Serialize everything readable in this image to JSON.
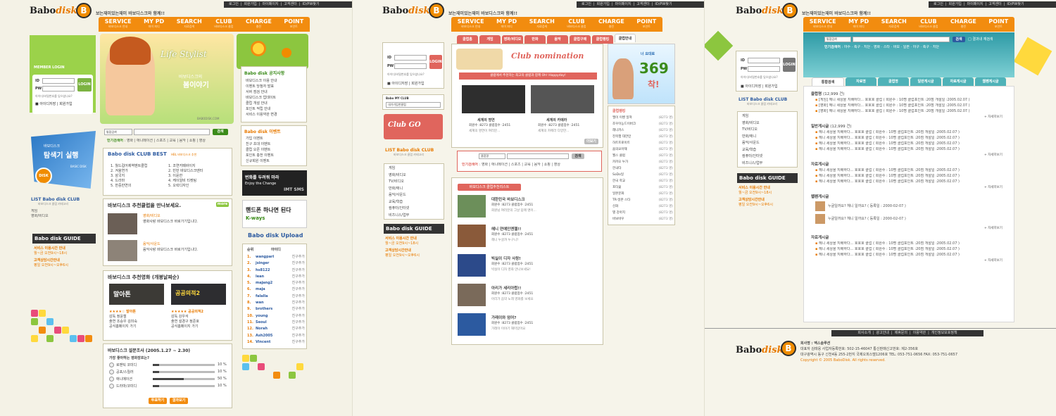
{
  "brand": {
    "logo_main": "Babo",
    "logo_accent": "disk",
    "mascot_letter": "B",
    "slogan": "보는재미있는재미 바보디스크와 함께!!"
  },
  "toplinks": [
    "로그인",
    "회원가입",
    "마이페이지",
    "고객센터",
    "ID/PW찾기"
  ],
  "nav": [
    {
      "label": "SERVICE",
      "sub": "바보디스크 안내"
    },
    {
      "label": "MY PD",
      "sub": "마이 피디"
    },
    {
      "label": "SEARCH",
      "sub": "자료검색"
    },
    {
      "label": "CLUB",
      "sub": "바보디스크 클럽"
    },
    {
      "label": "CHARGE",
      "sub": "충전"
    },
    {
      "label": "POINT",
      "sub": "포인트"
    }
  ],
  "login": {
    "title": "MEMBER LOGIN",
    "id_label": "ID",
    "pw_label": "PW",
    "button": "LOGIN",
    "hint": "아이디/비밀번호를 잊으셨나요?",
    "save": "아이디저장",
    "join": "회원가입"
  },
  "explorer": {
    "small": "바보디스크",
    "title": "탐색기 실행",
    "tag": "BASIC DISK",
    "mark": "DISK"
  },
  "list_menu": {
    "title": "LIST Babo disk CLUB",
    "subtitle": "바보디스크 클럽 카테고리",
    "items": [
      "게임",
      "영화/비디오",
      "TV/비디오",
      "만화/애니",
      "음악/사운드",
      "교육/학습",
      "컴퓨터/인터넷",
      "비즈니스/업무"
    ]
  },
  "guide": {
    "title": "Babo disk GUIDE",
    "items": [
      "서비스 이용시간 안내",
      "고객상담시간안내"
    ],
    "hours": [
      "월~금 오전9시~18시",
      "평일 오전9시~오후6시"
    ]
  },
  "hero": {
    "title": "Life Stylist",
    "small": "바보디스크의",
    "big": "봄이야기",
    "url": "BABODISK.COM"
  },
  "search": {
    "select": "통합검색",
    "button": "검색"
  },
  "keywords": {
    "label": "인기검색어",
    "items": [
      "영화",
      "애니메이션",
      "스포츠",
      "교육",
      "음악",
      "쇼핑",
      "영상"
    ]
  },
  "club_best": {
    "title": "Babo disk CLUB BEST",
    "tag": "HBL 바보디스크 추천",
    "left": [
      "월드컵어제역벤트클럽",
      "겨울연가",
      "삼국지",
      "드라마",
      "한중만연의"
    ],
    "right": [
      "조연카페바이지",
      "빈빈 바보디스크엔터",
      "이윤한",
      "케이알비 티켓팅",
      "오락디자인"
    ]
  },
  "recommend": {
    "title": "바보디스크 추천클럽을 만나보세요.",
    "more": "more",
    "items": [
      {
        "cat": "영화/비디오",
        "desc": "영화사랑 바보디스크 바로가기입니다."
      },
      {
        "cat": "음악/사운드",
        "desc": "음악사랑 바보디스크 바로가기입니다."
      }
    ]
  },
  "movie": {
    "title": "바보디스크 추천영화 (개봉날짜순)",
    "items": [
      {
        "poster": "말아톤",
        "rating": "★★★★☆ 말아톤",
        "info": [
          "감독 정윤철",
          "출연 조승우 김미숙",
          "공식홈페이지 가기"
        ]
      },
      {
        "poster": "공공의적2",
        "rating": "★★★★★ 공공의적2",
        "info": [
          "감독 강우석",
          "출연 설경구 정준호",
          "공식홈페이지 가기"
        ]
      }
    ]
  },
  "poll": {
    "title": "바보디스크 설문조사 (2005.1.27 ~ 2.30)",
    "question": "가장 좋아하는 영화장르는?",
    "options": [
      {
        "label": "로맨틱 코미디",
        "pct": 10
      },
      {
        "label": "공포/스릴러",
        "pct": 10
      },
      {
        "label": "애니메이션",
        "pct": 50
      },
      {
        "label": "드라마/코미디",
        "pct": 10
      }
    ],
    "unit": "%",
    "buttons": [
      "투표하기",
      "결과보기"
    ]
  },
  "right_col": {
    "notice_title": "Babo disk 공지사항",
    "notice": [
      "바보디스크 이용 안내",
      "이벤트 당첨자 발표",
      "서버 점검 안내",
      "바보디스크 업데이트",
      "클럽 개설 안내",
      "포인트 적립 안내",
      "서비스 이용약관 변경"
    ],
    "event_title": "Babo disk 이벤트",
    "event": [
      "가입 이벤트",
      "친구 초대 이벤트",
      "클럽 오픈 이벤트",
      "포인트 충전 이벤트",
      "신규회원 이벤트"
    ],
    "banner1": [
      "번화를 두려워 마라",
      "Enjoy the Change",
      "IMT SMS"
    ],
    "banner2": [
      "핸드폰 하나면 된다",
      "K-ways"
    ],
    "upload_title": "Babo disk Upload",
    "upload_cols": [
      "순위",
      "아이디"
    ],
    "upload": [
      "wangpari",
      "jsinger",
      "hs8122",
      "lean",
      "majang2",
      "maja",
      "falalla",
      "wan",
      "brothers",
      "young",
      "Seoul",
      "Norah",
      "Ash2005",
      "Vincent"
    ],
    "upload_action": "친구추가"
  },
  "p2": {
    "tabs": [
      "클럽홈",
      "게임",
      "영화/비디오",
      "만화",
      "음악",
      "클럽구매",
      "클럽랭킹",
      "클럽안내"
    ],
    "my_club": {
      "title": "Babo MY CLUB",
      "select": "내가가입한클럽"
    },
    "banner": "Club GO",
    "nomination": {
      "title": "Club nomination",
      "sub": "클럽에서 추천하는 최고의 클럽과 함께 Oh! Happyday!"
    },
    "nom_items": [
      {
        "name": "세계의 명연",
        "info": "회원수 :8273 클럽점수 :2451",
        "desc": "세계의 명연이 여러분..."
      },
      {
        "name": "세계의 카메라",
        "info": "회원수 :8273 클럽점수 :2451",
        "desc": "세계의 카메라 다양한..."
      }
    ],
    "more": "더보기",
    "search_select": "클럽명",
    "search_button": "검색",
    "keyword_label": "인기검색어",
    "keywords": [
      "영화",
      "애니메이션",
      "스포츠",
      "교육",
      "음악",
      "쇼핑",
      "영상"
    ],
    "rec_title": "바보디스크 클럽추천리스트",
    "rec_items": [
      {
        "name": "대한민국 바보디스크",
        "info": "회원수 :8273 클럽점수 :2451",
        "desc": "회원님 여러분의 그날 답례 명이..."
      },
      {
        "name": "헤니 연예인엔젤!!",
        "info": "회원수 :8273 클럽점수 :2451",
        "desc": "헤니 누굴까 누구니?"
      },
      {
        "name": "빅실이 디자 사랑!",
        "info": "회원수 :8273 클럽점수 :2451",
        "desc": "빅실이 디자 영화 만나보세요!"
      },
      {
        "name": "아리가 세리아럽!!",
        "info": "회원수 :8273 클럽점수 :2451",
        "desc": "아리가 음악 노래 영화를 보세요"
      },
      {
        "name": "가래이와 엄어?",
        "info": "회원수 :8273 클럽점수 :2451",
        "desc": "가래이 이야기 재미있어요"
      }
    ],
    "ad": {
      "small": "너 요대로",
      "num": "369",
      "tag": "착!"
    },
    "side_title": "클럽랭킹",
    "side_list": [
      "엘이 이벤 일져",
      "조우이능드이버크",
      "레니카스",
      "진목행 대한민",
      "하트프로이트",
      "윰의요아재",
      "월스 클럽",
      "카카오 누가",
      "한국타",
      "SoDo일",
      "한국 학교",
      "포타꽃",
      "일본문화",
      "TR-일본 스타",
      "신화",
      "별 강아지",
      "바보바우"
    ],
    "side_count": "(8273 명)"
  },
  "p3": {
    "search_select": "통합검색",
    "search_button": "검색",
    "search_check": "결과내 재검색",
    "keyword_label": "인기검색어",
    "keywords": [
      "야수",
      "축구",
      "지단",
      "영화",
      "스타",
      "바보",
      "일본",
      "야구",
      "축구",
      "지단"
    ],
    "tabs": [
      "통합검색",
      "자료명",
      "클럽명",
      "일반게시글",
      "자료게시글",
      "웹펜게시글"
    ],
    "sec1": {
      "title": "클럽명",
      "count": "(12,999 건)",
      "items": [
        "[게임] 헤니 세상을 지배하다... 호호호 클럽 ( 회원수 : 10명 클럽포인트 :20점 개설일 :2005.02.07 )",
        "[영화] 헤니 세상을 지배하다... 호호호 클럽 ( 회원수 : 10명 클럽포인트 :20점 개설일 :2005.02.07 )",
        "[영화] 헤니 세상을 지배하다... 호호호 클럽 ( 회원수 : 10명 클럽포인트 :20점 개설일 :2005.02.07 )"
      ]
    },
    "sec2": {
      "title": "일반게시글",
      "count": "(12,999 건)",
      "items": [
        "헤니 세상을 지배하다... 호호호 클럽 ( 회원수 : 10명 클럽포인트 :20점 개설일 :2005.02.07 )",
        "헤니 세상을 지배하다... 호호호 클럽 ( 회원수 : 10명 클럽포인트 :20점 개설일 :2005.02.07 )",
        "헤니 세상을 지배하다... 호호호 클럽 ( 회원수 : 10명 클럽포인트 :20점 개설일 :2005.02.07 )",
        "헤니 세상을 지배하다... 호호호 클럽 ( 회원수 : 10명 클럽포인트 :20점 개설일 :2005.02.07 )"
      ]
    },
    "sec3": {
      "title": "자료게시글",
      "items": [
        "헤니 세상을 지배하다... 호호호 클럽 ( 회원수 : 10명 클럽포인트 :20점 개설일 :2005.02.07 )",
        "헤니 세상을 지배하다... 호호호 클럽 ( 회원수 : 10명 클럽포인트 :20점 개설일 :2005.02.07 )",
        "헤니 세상을 지배하다... 호호호 클럽 ( 회원수 : 10명 클럽포인트 :20점 개설일 :2005.02.07 )"
      ]
    },
    "sec4": {
      "title": "웹펜게시글",
      "items": [
        "누굴일까요? 헤니 일까요? ( 등록일 : 2000-02-07 )",
        "누굴일까요? 헤니 일까요? ( 등록일 : 2000-02-07 )"
      ]
    },
    "sec5": {
      "title": "자료게시글",
      "items": [
        "헤니 세상을 지배하다... 호호호 클럽 ( 회원수 : 10명 클럽포인트 :20점 개설일 :2005.02.07 )",
        "헤니 세상을 지배하다... 호호호 클럽 ( 회원수 : 10명 클럽포인트 :20점 개설일 :2005.02.07 )",
        "헤니 세상을 지배하다... 호호호 클럽 ( 회원수 : 10명 클럽포인트 :20점 개설일 :2005.02.07 )"
      ]
    },
    "more": "+ 자세히보기",
    "footer_links": [
      "회사소개",
      "광고안내",
      "제휴문의",
      "이용약관",
      "개인정보보호정책"
    ],
    "footer": {
      "company": "회사명 : 엑스솔루션",
      "line1": "대표자 김태웅 사업자등록번호: 502-15-46047 통신판매신고번호: 제2-356호",
      "line2": "대구광역시 동구 신천4동 255-2번지 국제오피스텔1206호 TEL: 053-751-0656 FAX: 053-751-0657",
      "copy": "Copyright © 2005 BaboDisk. All rights reserved."
    }
  },
  "colors": {
    "orange": "#f28c0f",
    "green": "#8cc63f",
    "pink": "#e0655d",
    "blue": "#2c6fb4"
  }
}
